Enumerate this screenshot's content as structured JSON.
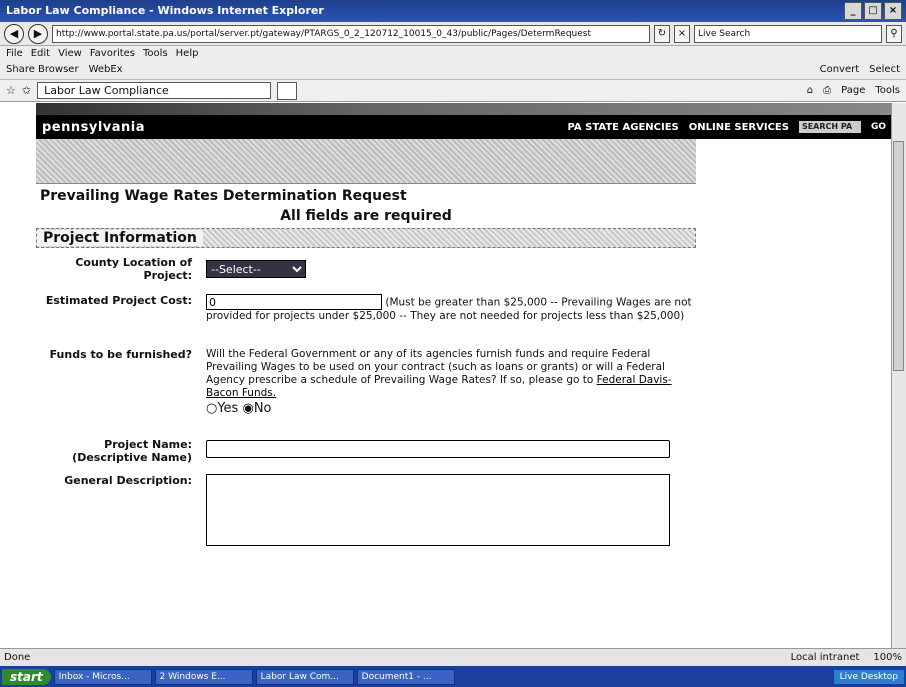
{
  "window": {
    "title": "Labor Law Compliance - Windows Internet Explorer"
  },
  "address_bar": {
    "url": "http://www.portal.state.pa.us/portal/server.pt/gateway/PTARGS_0_2_120712_10015_0_43/public/Pages/DetermRequest",
    "search_placeholder": "Live Search"
  },
  "menu": [
    "File",
    "Edit",
    "View",
    "Favorites",
    "Tools",
    "Help"
  ],
  "links_bar": {
    "items": [
      "Share Browser",
      "WebEx"
    ],
    "right": [
      "Convert",
      "Select"
    ]
  },
  "tab": {
    "label": "Labor Law Compliance"
  },
  "tab_tools": [
    "Page",
    "Tools"
  ],
  "site": {
    "logo": "pennsylvania",
    "nav": [
      "PA STATE AGENCIES",
      "ONLINE SERVICES"
    ],
    "search_label": "SEARCH PA",
    "go": "GO"
  },
  "form": {
    "title": "Prevailing Wage Rates Determination Request",
    "required_note": "All fields are required",
    "section": "Project Information",
    "county_label": "County Location of Project:",
    "county_value": "--Select--",
    "cost_label": "Estimated Project Cost:",
    "cost_value": "0",
    "cost_note": "(Must be greater than $25,000 -- Prevailing Wages are not provided for projects under $25,000 -- They are not needed for projects less than $25,000)",
    "funds_label": "Funds to be furnished?",
    "funds_text": "Will the Federal Government or any of its agencies furnish funds and require Federal Prevailing Wages to be used on your contract (such as loans or grants) or will a Federal Agency prescribe a schedule of Prevailing Wage Rates? If so, please go to",
    "funds_link": "Federal Davis-Bacon Funds.",
    "yes": "Yes",
    "no": "No",
    "name_label": "Project Name: (Descriptive Name)",
    "desc_label": "General Description:"
  },
  "status_bar": {
    "left": "Done",
    "zone": "Local intranet",
    "zoom": "100%"
  },
  "taskbar": {
    "start": "start",
    "tasks": [
      "Inbox - Micros...",
      "2 Windows E...",
      "Labor Law Com...",
      "Document1 - ..."
    ],
    "tray": "Live Desktop"
  }
}
